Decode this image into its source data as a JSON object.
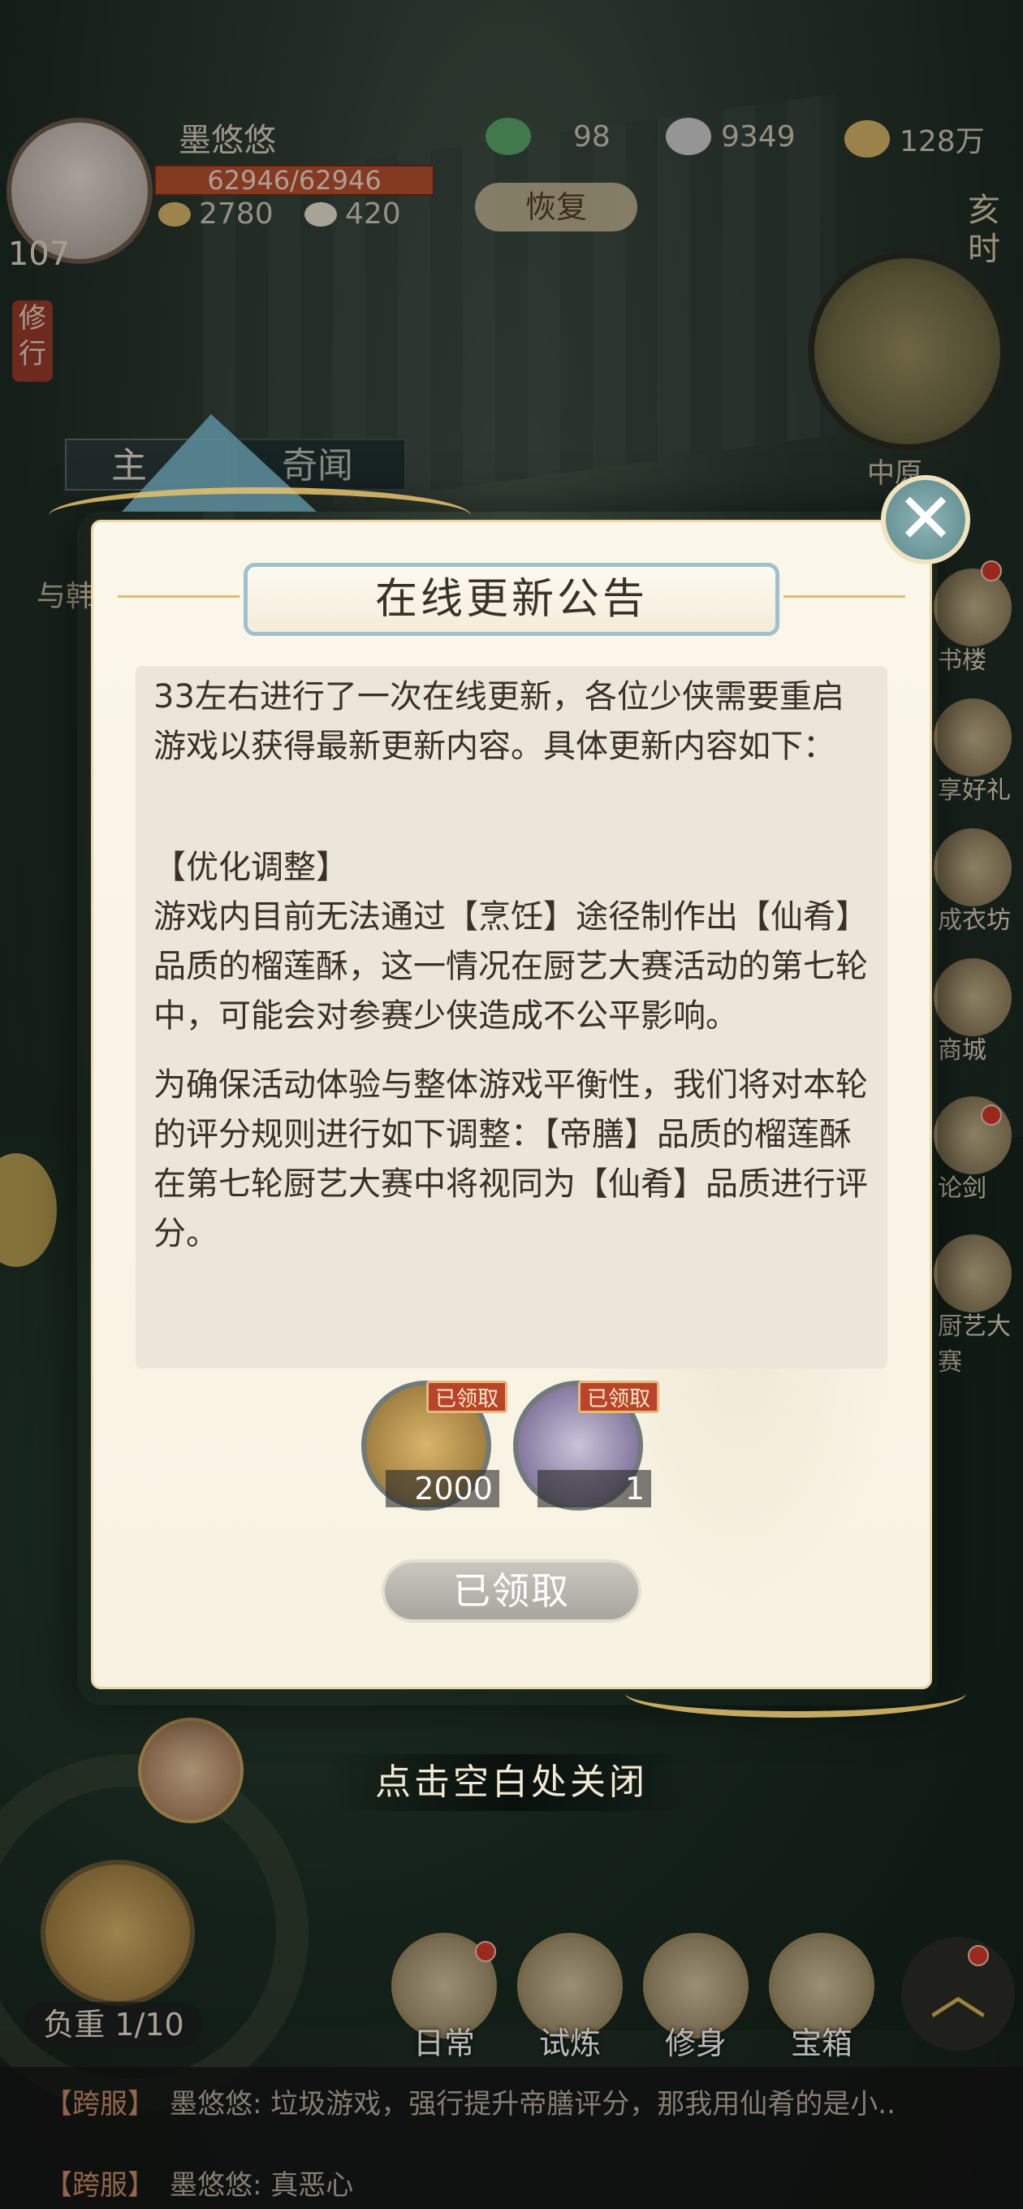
{
  "player": {
    "name": "墨悠悠",
    "hp": "62946/62946",
    "level": "107",
    "stamina": "2780",
    "food": "420",
    "recover_label": "恢复"
  },
  "currencies": [
    {
      "icon": "jade-dragon-icon",
      "value": "98"
    },
    {
      "icon": "silver-ingot-icon",
      "value": "9349"
    },
    {
      "icon": "copper-coins-icon",
      "value": "128万"
    }
  ],
  "time_label": "亥时",
  "region": "中原",
  "side_tag": "修行",
  "tabs": [
    {
      "label": "主"
    },
    {
      "label": "奇闻"
    }
  ],
  "quest_text": "与韩",
  "side_icons": [
    {
      "label": "书楼",
      "icon": "book-tower-icon"
    },
    {
      "label": "享好礼",
      "icon": "gift-icon"
    },
    {
      "label": "成衣坊",
      "icon": "tailor-icon"
    },
    {
      "label": "商城",
      "icon": "shop-icon"
    },
    {
      "label": "论剑",
      "icon": "sword-icon"
    },
    {
      "label": "厨艺大赛",
      "icon": "cooking-contest-icon"
    }
  ],
  "modal": {
    "title": "在线更新公告",
    "paragraphs": [
      "33左右进行了一次在线更新，各位少侠需要重启游戏以获得最新更新内容。具体更新内容如下：",
      "【优化调整】",
      "游戏内目前无法通过【烹饪】途径制作出【仙肴】品质的榴莲酥，这一情况在厨艺大赛活动的第七轮中，可能会对参赛少侠造成不公平影响。",
      "为确保活动体验与整体游戏平衡性，我们将对本轮的评分规则进行如下调整：【帝膳】品质的榴莲酥在第七轮厨艺大赛中将视同为【仙肴】品质进行评分。"
    ],
    "rewards": [
      {
        "icon": "copper-coins-icon",
        "count": "2000",
        "status": "已领取"
      },
      {
        "icon": "go-board-vase-icon",
        "count": "1",
        "status": "已领取"
      }
    ],
    "claim_button": "已领取",
    "close_hint": "点击空白处关闭"
  },
  "bottom": {
    "load_label": "负重 1/10",
    "dock": [
      {
        "label": "日常",
        "icon": "daily-icon"
      },
      {
        "label": "试炼",
        "icon": "trial-icon"
      },
      {
        "label": "修身",
        "icon": "cultivation-icon"
      },
      {
        "label": "宝箱",
        "icon": "chest-icon"
      }
    ]
  },
  "chat": [
    {
      "channel": "【跨服】",
      "text": "墨悠悠: 垃圾游戏，强行提升帝膳评分，那我用仙肴的是小.."
    },
    {
      "channel": "【跨服】",
      "text": "墨悠悠: 真恶心"
    }
  ],
  "colors": {
    "accent_gold": "#e6c36e",
    "claimed_badge": "#b8442a",
    "title_border": "#9fc0cc",
    "hp_bar": "#b8502e"
  }
}
